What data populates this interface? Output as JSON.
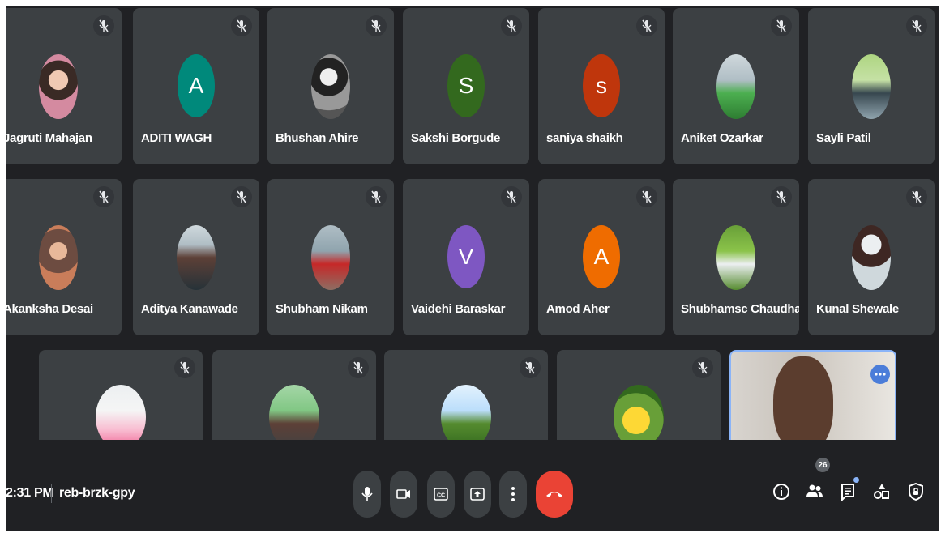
{
  "meeting": {
    "time": "2:31 PM",
    "code": "reb-brzk-gpy",
    "participant_count": "26"
  },
  "participants_row1": [
    {
      "name": "Jagruti Mahajan",
      "avatar": "photo-pink",
      "muted": true
    },
    {
      "name": "ADITI WAGH",
      "avatar": "A",
      "avatar_color": "#00897b",
      "muted": true
    },
    {
      "name": "Bhushan Ahire",
      "avatar": "photo-bw",
      "muted": true
    },
    {
      "name": "Sakshi Borgude",
      "avatar": "S",
      "avatar_color": "#33691e",
      "muted": true
    },
    {
      "name": "saniya shaikh",
      "avatar": "s",
      "avatar_color": "#bf360c",
      "muted": true
    },
    {
      "name": "Aniket Ozarkar",
      "avatar": "photo-green",
      "muted": true
    },
    {
      "name": "Sayli Patil",
      "avatar": "photo-outdoor",
      "muted": true
    }
  ],
  "participants_row2": [
    {
      "name": "Akanksha Desai",
      "avatar": "photo-warm",
      "muted": true
    },
    {
      "name": "Aditya Kanawade",
      "avatar": "photo-blue",
      "muted": true
    },
    {
      "name": "Shubham Nikam",
      "avatar": "photo-red",
      "muted": true
    },
    {
      "name": "Vaidehi Baraskar",
      "avatar": "V",
      "avatar_color": "#7e57c2",
      "muted": true
    },
    {
      "name": "Amod Aher",
      "avatar": "A",
      "avatar_color": "#ef6c00",
      "muted": true
    },
    {
      "name": "Shubhamsc Chaudhari",
      "avatar": "photo-green2",
      "muted": true
    },
    {
      "name": "Kunal Shewale",
      "avatar": "photo-white",
      "muted": true
    }
  ],
  "participants_row3": [
    {
      "name": "",
      "avatar": "photo-light",
      "muted": true
    },
    {
      "name": "",
      "avatar": "photo-bike",
      "muted": true
    },
    {
      "name": "",
      "avatar": "photo-sky",
      "muted": true
    },
    {
      "name": "",
      "avatar": "photo-flower",
      "muted": true
    }
  ],
  "controls": {
    "mic": "microphone-icon",
    "camera": "camera-icon",
    "captions": "captions-icon",
    "present": "present-icon",
    "more": "more-options-icon",
    "end": "end-call-icon"
  },
  "right_controls": [
    "info-icon",
    "people-icon",
    "chat-icon",
    "activities-icon",
    "host-controls-icon"
  ]
}
